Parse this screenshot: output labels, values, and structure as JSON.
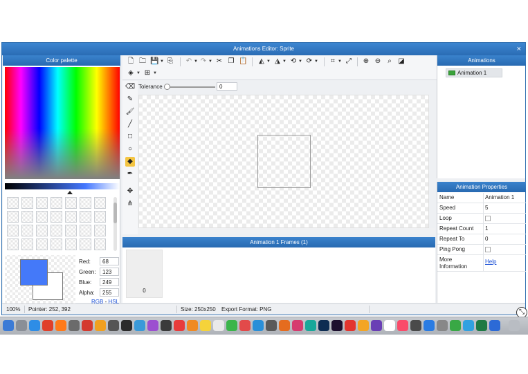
{
  "window": {
    "title": "Animations Editor: Sprite",
    "close_glyph": "×"
  },
  "palette": {
    "title": "Color palette",
    "foreground_color": "#4479f9",
    "background_color": "#ffffff",
    "red_label": "Red:",
    "red": "68",
    "green_label": "Green:",
    "green": "123",
    "blue_label": "Blue:",
    "blue": "249",
    "alpha_label": "Alpha:",
    "alpha": "255",
    "rgb_link": "RGB",
    "separator": "-",
    "hsl_link": "HSL"
  },
  "toolbar": {
    "tolerance_label": "Tolerance",
    "tolerance_value": "0"
  },
  "frames": {
    "title": "Animation 1 Frames (1)",
    "frame_index": "0"
  },
  "animations": {
    "title": "Animations",
    "items": [
      {
        "label": "Animation 1"
      }
    ]
  },
  "properties": {
    "title": "Animation Properties",
    "rows": [
      {
        "name": "Name",
        "value": "Animation 1"
      },
      {
        "name": "Speed",
        "value": "5"
      },
      {
        "name": "Loop",
        "value": ""
      },
      {
        "name": "Repeat Count",
        "value": "1"
      },
      {
        "name": "Repeat To",
        "value": "0"
      },
      {
        "name": "Ping Pong",
        "value": ""
      },
      {
        "name": "More Information",
        "value": "Help"
      }
    ]
  },
  "status": {
    "zoom": "100%",
    "pointer": "Pointer: 252, 392",
    "size": "Size: 250x250",
    "export": "Export Format: PNG"
  }
}
